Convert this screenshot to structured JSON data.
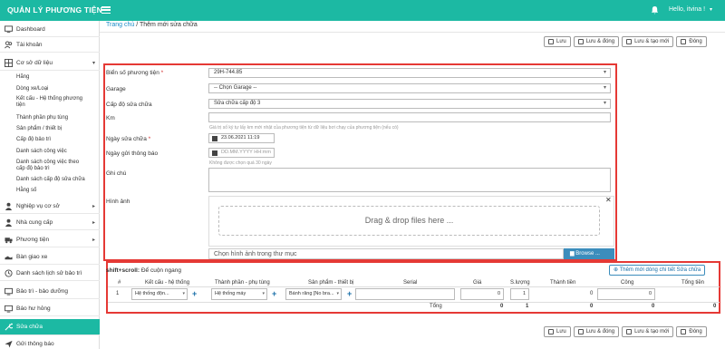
{
  "app": {
    "brand": "QUẢN LÝ PHƯƠNG TIỆN",
    "greeting": "Hello, itvina !"
  },
  "sidebar": {
    "items": [
      {
        "label": "Dashboard",
        "icon": "monitor-icon"
      },
      {
        "label": "Tài khoản",
        "icon": "users-icon"
      },
      {
        "label": "Cơ sở dữ liệu",
        "icon": "database-icon",
        "expanded": true
      }
    ],
    "subitems": [
      "Hãng",
      "Dòng xe/Loại",
      "Kết cấu - Hệ thống phương tiện",
      "Thành phần phụ tùng",
      "Sản phẩm / thiết bị",
      "Cấp độ bảo trì",
      "Danh sách công việc",
      "Danh sách công việc theo cấp độ bảo trì",
      "Danh sách cấp độ sửa chữa",
      "Hằng số"
    ],
    "items2": [
      {
        "label": "Nghiệp vụ cơ sở",
        "icon": "person-icon"
      },
      {
        "label": "Nhà cung cấp",
        "icon": "person-icon"
      },
      {
        "label": "Phương tiện",
        "icon": "truck-icon"
      },
      {
        "label": "Bàn giao xe",
        "icon": "handover-icon"
      },
      {
        "label": "Danh sách lịch sử bảo trì",
        "icon": "history-icon"
      },
      {
        "label": "Bảo trì - bảo dưỡng",
        "icon": "wrench-icon"
      },
      {
        "label": "Báo hư hỏng",
        "icon": "bug-icon"
      },
      {
        "label": "Sửa chữa",
        "icon": "repair-icon"
      },
      {
        "label": "Gửi thông báo",
        "icon": "send-icon"
      }
    ]
  },
  "breadcrumb": {
    "home": "Trang chủ",
    "sep": "/",
    "current": "Thêm mới sửa chữa"
  },
  "actions": {
    "save": "Lưu",
    "save_close": "Lưu & đóng",
    "save_new": "Lưu & tạo mới",
    "close": "Đóng"
  },
  "form": {
    "plate_label": "Biển số phương tiện",
    "plate_value": "29H-744.85",
    "garage_label": "Garage",
    "garage_value": "-- Chọn Garage --",
    "level_label": "Cấp độ sửa chữa",
    "level_value": "Sửa chữa cấp độ 3",
    "km_label": "Km",
    "km_hint": "Giá trị số ký tự lấy km mới nhật của phương tiện từ dữ liệu bơi chạy của phương tiện (nếu có)",
    "date_label": "Ngày sửa chữa",
    "date_value": "23.06.2021 11:19",
    "notify_label": "Ngày gửi thông báo",
    "notify_placeholder": "DD.MM.YYYY HH:mm",
    "notify_hint": "Không được chọn quá 30 ngày",
    "note_label": "Ghi chú",
    "image_label": "Hình ảnh",
    "dropzone": "Drag & drop files here ...",
    "file_placeholder": "Chọn hình ảnh trong thư mục",
    "browse": "Browse ..."
  },
  "table": {
    "shift_hint_bold": "shift+scroll:",
    "shift_hint": " Để cuộn ngang",
    "add_line": "Thêm mới dòng chi tiết Sửa chữa",
    "headers": [
      "#",
      "Kết cấu - hệ thống",
      "Thành phần - phụ tùng",
      "Sản phẩm - thiết bị",
      "Serial",
      "Giá",
      "S.lượng",
      "Thành tiền",
      "Công",
      "Tổng tiền"
    ],
    "row": {
      "idx": "1",
      "system": "Hệ thống độn...",
      "part": "Hệ thống máy",
      "product": "Bánh răng [No bra...",
      "price": "0",
      "qty": "1",
      "amount": "0",
      "labor": "0"
    },
    "total_label": "Tổng",
    "totals": {
      "price": "0",
      "qty": "1",
      "amount": "0",
      "labor": "0",
      "sum": "0"
    }
  }
}
